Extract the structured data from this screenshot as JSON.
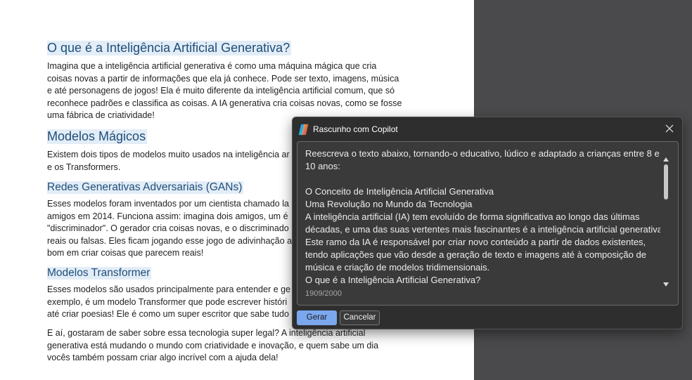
{
  "document": {
    "sections": [
      {
        "heading": "O que é a Inteligência Artificial Generativa?",
        "lines": [
          "Imagina que a inteligência artificial generativa é como uma máquina mágica que cria",
          "coisas novas a partir de informações que ela já conhece. Pode ser texto, imagens, música",
          "e até personagens de jogos! Ela é muito diferente da inteligência artificial comum, que só",
          "reconhece padrões e classifica as coisas. A IA generativa cria coisas novas, como se fosse",
          "uma fábrica de criatividade!"
        ]
      },
      {
        "heading": "Modelos Mágicos",
        "lines": [
          "Existem dois tipos de modelos muito usados na inteligência ar",
          "e os Transformers."
        ]
      },
      {
        "heading": "Redes Generativas Adversariais (GANs)",
        "lines": [
          "Esses modelos foram inventados por um cientista chamado la",
          "amigos em 2014. Funciona assim: imagina dois amigos, um é",
          "\"discriminador\". O gerador cria coisas novas, e o discriminado",
          "reais ou falsas. Eles ficam jogando esse jogo de adivinhação a",
          "bom em criar coisas que parecem reais!"
        ]
      },
      {
        "heading": "Modelos Transformer",
        "lines": [
          "Esses modelos são usados principalmente para entender e ge",
          "exemplo, é um modelo Transformer que pode escrever históri",
          "até criar poesias! Ele é como um super escritor que sabe tudo"
        ]
      },
      {
        "heading": "",
        "lines": [
          "E aí, gostaram de saber sobre essa tecnologia super legal? A inteligência artificial",
          "generativa está mudando o mundo com criatividade e inovação, e quem sabe um dia",
          "vocês também possam criar algo incrível com a ajuda dela!"
        ]
      }
    ]
  },
  "copilot": {
    "title": "Rascunho com Copilot",
    "icon": "copilot-logo-icon",
    "prompt_lines": [
      "Reescreva o texto abaixo, tornando-o educativo, lúdico e adaptado a crianças entre 8 e",
      "10 anos:",
      "",
      "O Conceito de Inteligência Artificial Generativa",
      "Uma Revolução no Mundo da Tecnologia",
      "A inteligência artificial (IA) tem evoluído de forma significativa ao longo das últimas",
      "décadas, e uma das suas vertentes mais fascinantes é a inteligência artificial generativa.",
      "Este ramo da IA é responsável por criar novo conteúdo a partir de dados existentes,",
      "tendo aplicações que vão desde a geração de texto e imagens até à composição de",
      "música e criação de modelos tridimensionais.",
      "O que é a Inteligência Artificial Generativa?"
    ],
    "char_count": "1909/2000",
    "buttons": {
      "generate": "Gerar",
      "cancel": "Cancelar"
    },
    "colors": {
      "accent": "#7aa7ee",
      "dialog_bg": "#2e2e2e",
      "heading": "#1e4e79"
    }
  }
}
